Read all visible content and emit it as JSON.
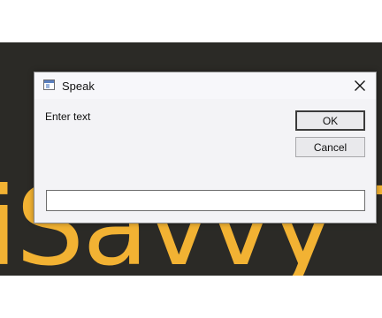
{
  "background": {
    "brand_text": "iSavvy T"
  },
  "dialog": {
    "title": "Speak",
    "prompt_label": "Enter text",
    "ok_label": "OK",
    "cancel_label": "Cancel",
    "input_value": "",
    "icons": {
      "app": "window-icon",
      "close": "close-icon"
    }
  },
  "colors": {
    "background": "#2b2a26",
    "brand_text": "#f2b233",
    "dialog_bg": "#f3f3f6"
  }
}
